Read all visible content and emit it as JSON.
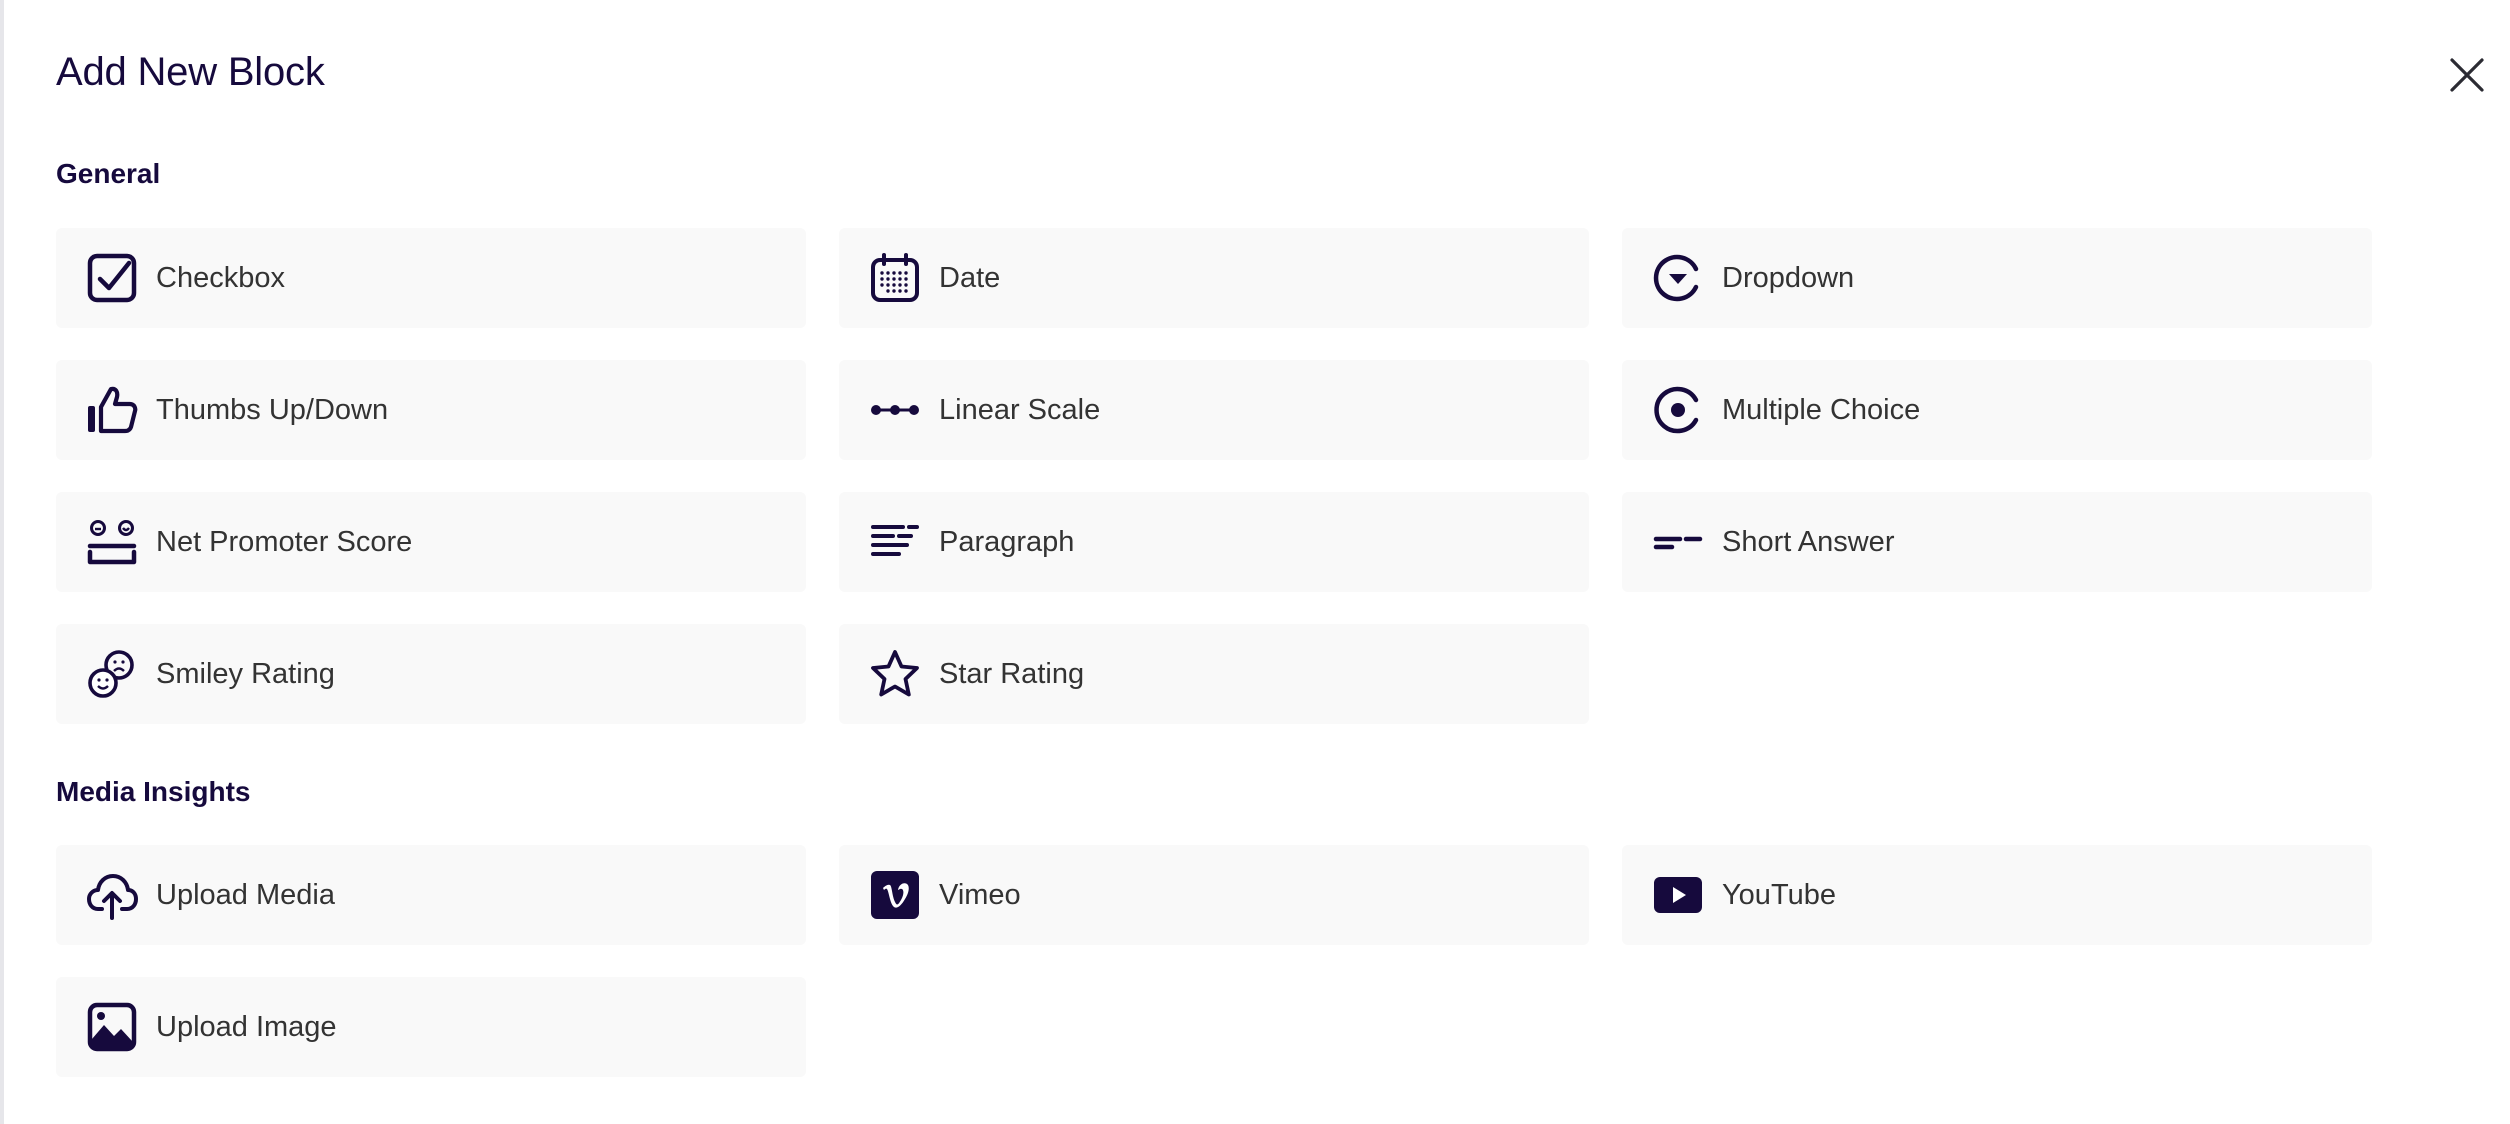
{
  "dialog": {
    "title": "Add New Block",
    "close_icon": "close-icon",
    "accent_color": "#160a3d"
  },
  "sections": [
    {
      "title": "General",
      "items": [
        {
          "label": "Checkbox",
          "icon": "checkbox-icon"
        },
        {
          "label": "Date",
          "icon": "calendar-icon"
        },
        {
          "label": "Dropdown",
          "icon": "dropdown-icon"
        },
        {
          "label": "Thumbs Up/Down",
          "icon": "thumbs-up-icon"
        },
        {
          "label": "Linear Scale",
          "icon": "linear-scale-icon"
        },
        {
          "label": "Multiple Choice",
          "icon": "radio-icon"
        },
        {
          "label": "Net Promoter Score",
          "icon": "nps-icon"
        },
        {
          "label": "Paragraph",
          "icon": "paragraph-icon"
        },
        {
          "label": "Short Answer",
          "icon": "short-answer-icon"
        },
        {
          "label": "Smiley Rating",
          "icon": "smiley-icon"
        },
        {
          "label": "Star Rating",
          "icon": "star-icon"
        }
      ]
    },
    {
      "title": "Media Insights",
      "items": [
        {
          "label": "Upload Media",
          "icon": "cloud-upload-icon"
        },
        {
          "label": "Vimeo",
          "icon": "vimeo-icon"
        },
        {
          "label": "YouTube",
          "icon": "youtube-icon"
        },
        {
          "label": "Upload Image",
          "icon": "image-icon"
        }
      ]
    }
  ]
}
